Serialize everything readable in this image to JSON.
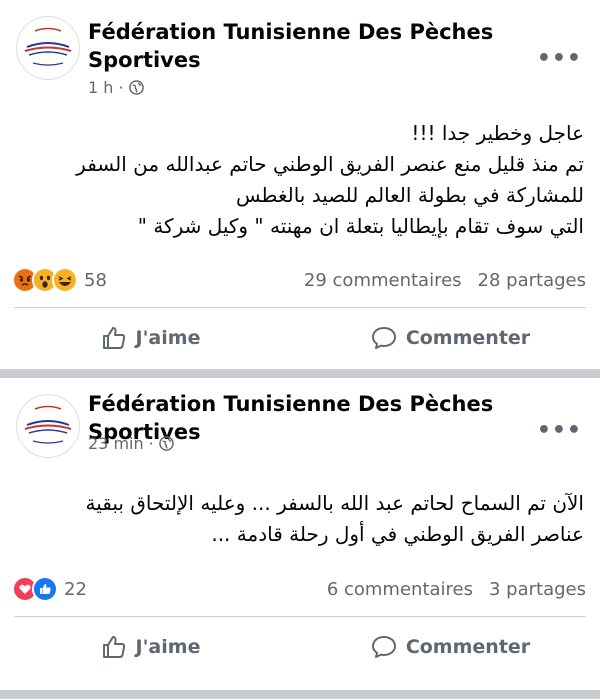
{
  "posts": [
    {
      "page_name": "Fédération Tunisienne Des Pèches Sportives",
      "time": "1 h",
      "visibility_icon": "globe-icon",
      "more_label": "•••",
      "body": "عاجل وخطير جدا !!!\nتم منذ قليل منع عنصر الفريق الوطني حاتم عبدالله  من السفر\nللمشاركة في بطولة العالم للصيد بالغطس\nالتي سوف تقام بإيطاليا  بتعلة ان مهنته \" وكيل شركة \"",
      "reaction_icons": [
        "angry-icon",
        "wow-icon",
        "haha-icon"
      ],
      "reaction_count": "58",
      "comments": "29 commentaires",
      "shares": "28 partages",
      "like_label": "J'aime",
      "comment_label": "Commenter"
    },
    {
      "page_name": "Fédération Tunisienne Des Pèches Sportives",
      "time": "23 min",
      "visibility_icon": "globe-icon",
      "more_label": "•••",
      "body": "الآن تم السماح  لحاتم عبد الله بالسفر ... وعليه الإلتحاق ببقية\nعناصر الفريق الوطني في أول رحلة قادمة ...",
      "reaction_icons": [
        "love-icon",
        "like-icon"
      ],
      "reaction_count": "22",
      "comments": "6 commentaires",
      "shares": "3 partages",
      "like_label": "J'aime",
      "comment_label": "Commenter"
    }
  ],
  "colors": {
    "text": "#050505",
    "muted": "#65676b",
    "separator": "#c9ccd1",
    "like_blue": "#1877f2",
    "love_red": "#f33e58",
    "angry_orange": "#e9710f",
    "wow_yellow": "#f7b125"
  }
}
